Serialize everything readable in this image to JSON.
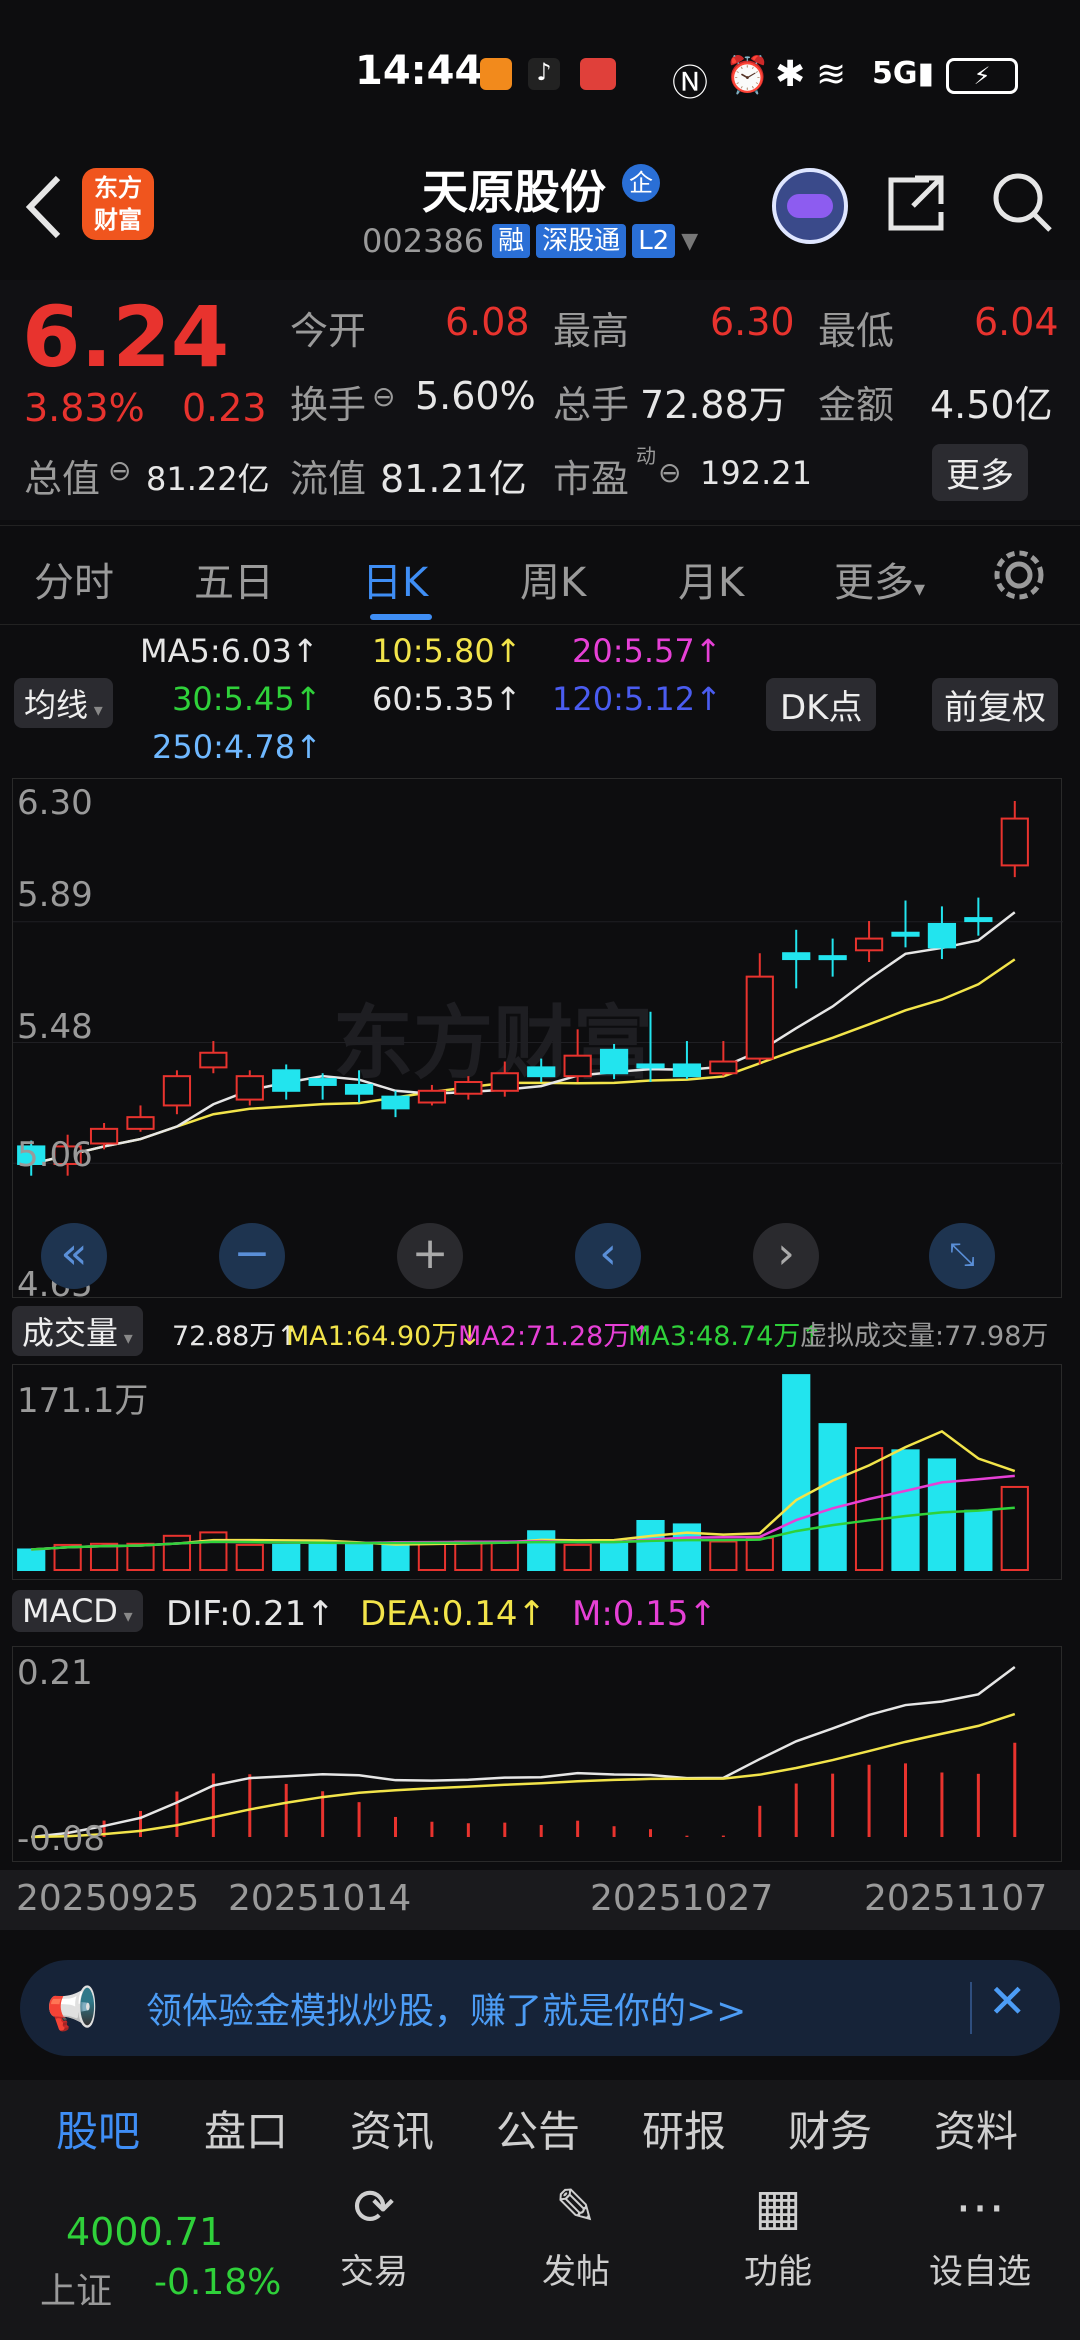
{
  "status_bar": {
    "time": "14:44"
  },
  "header": {
    "back_icon": "chevron-left-icon",
    "logo_text": "东方\n财富",
    "stock_name": "天原股份",
    "company_badge": "企",
    "code": "002386",
    "chips": [
      "融",
      "深股通",
      "L2"
    ]
  },
  "quote": {
    "price": "6.24",
    "change_pct": "3.83%",
    "change": "0.23",
    "open_label": "今开",
    "open": "6.08",
    "high_label": "最高",
    "high": "6.30",
    "low_label": "最低",
    "low": "6.04",
    "turnover_label": "换手",
    "turnover": "5.60%",
    "volume_label": "总手",
    "volume": "72.88万",
    "amount_label": "金额",
    "amount": "4.50亿",
    "mktcap_label": "总值",
    "mktcap": "81.22亿",
    "float_label": "流值",
    "float": "81.21亿",
    "pe_label": "市盈",
    "pe_sup": "动",
    "pe": "192.21",
    "more": "更多"
  },
  "tabs": [
    "分时",
    "五日",
    "日K",
    "周K",
    "月K",
    "更多"
  ],
  "ma": {
    "selector": "均线",
    "ma5": "MA5:6.03↑",
    "ma10": "10:5.80↑",
    "ma20": "20:5.57↑",
    "ma30": "30:5.45↑",
    "ma60": "60:5.35↑",
    "ma120": "120:5.12↑",
    "ma250": "250:4.78↑",
    "dk": "DK点",
    "adjust": "前复权"
  },
  "price_axis": [
    "6.30",
    "5.89",
    "5.48",
    "5.06",
    "4.65"
  ],
  "watermark": "东方财富",
  "volume": {
    "selector": "成交量",
    "vol": "72.88万↑",
    "ma1": "MA1:64.90万↓",
    "ma2": "MA2:71.28万↑",
    "ma3": "MA3:48.74万↑",
    "virtual": "虚拟成交量:77.98万",
    "max": "171.1万"
  },
  "macd": {
    "selector": "MACD",
    "dif": "DIF:0.21↑",
    "dea": "DEA:0.14↑",
    "m": "M:0.15↑",
    "top": "0.21",
    "bottom": "-0.08"
  },
  "dates": [
    "20250925",
    "20251014",
    "20251027",
    "20251107"
  ],
  "banner": {
    "text": "领体验金模拟炒股，赚了就是你的>>"
  },
  "bottom_tabs": [
    "股吧",
    "盘口",
    "资讯",
    "公告",
    "研报",
    "财务",
    "资料"
  ],
  "index": {
    "value": "4000.71",
    "name": "上证",
    "change": "-0.18%"
  },
  "nav": [
    "交易",
    "发帖",
    "功能",
    "设自选"
  ],
  "chart_data": {
    "type": "candlestick",
    "ylim": [
      4.65,
      6.3
    ],
    "candles": [
      {
        "open": 5.12,
        "close": 5.06,
        "high": 5.14,
        "low": 5.02
      },
      {
        "open": 5.06,
        "close": 5.12,
        "high": 5.16,
        "low": 5.02
      },
      {
        "open": 5.13,
        "close": 5.18,
        "high": 5.2,
        "low": 5.11
      },
      {
        "open": 5.18,
        "close": 5.22,
        "high": 5.26,
        "low": 5.17
      },
      {
        "open": 5.26,
        "close": 5.36,
        "high": 5.38,
        "low": 5.23
      },
      {
        "open": 5.39,
        "close": 5.44,
        "high": 5.48,
        "low": 5.37
      },
      {
        "open": 5.28,
        "close": 5.36,
        "high": 5.38,
        "low": 5.26
      },
      {
        "open": 5.38,
        "close": 5.31,
        "high": 5.4,
        "low": 5.28
      },
      {
        "open": 5.35,
        "close": 5.33,
        "high": 5.37,
        "low": 5.28
      },
      {
        "open": 5.33,
        "close": 5.3,
        "high": 5.38,
        "low": 5.27
      },
      {
        "open": 5.29,
        "close": 5.25,
        "high": 5.31,
        "low": 5.22
      },
      {
        "open": 5.27,
        "close": 5.31,
        "high": 5.33,
        "low": 5.26
      },
      {
        "open": 5.3,
        "close": 5.34,
        "high": 5.36,
        "low": 5.28
      },
      {
        "open": 5.31,
        "close": 5.37,
        "high": 5.41,
        "low": 5.29
      },
      {
        "open": 5.39,
        "close": 5.36,
        "high": 5.42,
        "low": 5.34
      },
      {
        "open": 5.36,
        "close": 5.43,
        "high": 5.52,
        "low": 5.34
      },
      {
        "open": 5.45,
        "close": 5.37,
        "high": 5.47,
        "low": 5.35
      },
      {
        "open": 5.4,
        "close": 5.39,
        "high": 5.58,
        "low": 5.34
      },
      {
        "open": 5.4,
        "close": 5.36,
        "high": 5.48,
        "low": 5.35
      },
      {
        "open": 5.37,
        "close": 5.41,
        "high": 5.48,
        "low": 5.36
      },
      {
        "open": 5.42,
        "close": 5.7,
        "high": 5.78,
        "low": 5.4
      },
      {
        "open": 5.78,
        "close": 5.76,
        "high": 5.86,
        "low": 5.66
      },
      {
        "open": 5.77,
        "close": 5.76,
        "high": 5.83,
        "low": 5.7
      },
      {
        "open": 5.79,
        "close": 5.83,
        "high": 5.89,
        "low": 5.75
      },
      {
        "open": 5.85,
        "close": 5.84,
        "high": 5.96,
        "low": 5.8
      },
      {
        "open": 5.88,
        "close": 5.8,
        "high": 5.94,
        "low": 5.76
      },
      {
        "open": 5.9,
        "close": 5.89,
        "high": 5.97,
        "low": 5.84
      },
      {
        "open": 6.08,
        "close": 6.24,
        "high": 6.3,
        "low": 6.04
      }
    ],
    "volume_max": 171.1,
    "volumes": [
      18,
      22,
      23,
      23,
      30,
      33,
      22,
      22,
      22,
      22,
      24,
      24,
      25,
      25,
      34,
      22,
      25,
      43,
      40,
      25,
      28,
      171,
      128,
      107,
      105,
      97,
      52,
      72.88
    ]
  }
}
